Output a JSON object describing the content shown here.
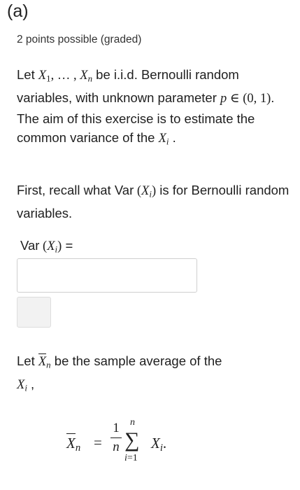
{
  "problem": {
    "heading": "(a)",
    "points": "2 points possible (graded)"
  },
  "intro": {
    "let": "Let",
    "var_x": "X",
    "sub_1": "1",
    "comma_dots": ", … , ",
    "sub_n": "n",
    "iid_text": " be i.i.d. Bernoulli random variables, with unknown parameter ",
    "var_p": "p",
    "in_set": " ∈ (0, 1)",
    "aim_text": ". The aim of this exercise is to estimate the common variance of the ",
    "sub_i": "i",
    "period": " ."
  },
  "recall": {
    "text_start": "First, recall what ",
    "var_word": "Var",
    "paren_open": " (",
    "paren_close": ")",
    "text_end": " is for Bernoulli random variables."
  },
  "question": {
    "label_var": "Var",
    "equals": " ="
  },
  "answer": {
    "value": "",
    "placeholder": ""
  },
  "sample_avg": {
    "let": "Let ",
    "text_mid": " be the sample average of the ",
    "trail": " ,"
  },
  "formula": {
    "x": "X",
    "n": "n",
    "equals": "=",
    "one": "1",
    "sigma": "∑",
    "upper": "n",
    "lower": "i=1",
    "term_sub": "i",
    "dot": "."
  }
}
